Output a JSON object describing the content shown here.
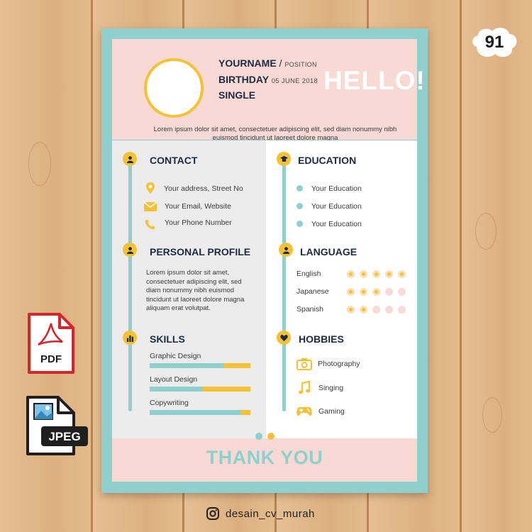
{
  "badge": {
    "number": "91"
  },
  "header": {
    "name": "YOURNAME",
    "slash": " / ",
    "position": "POSITION",
    "birthday_label": "BIRTHDAY",
    "birthday_value": "05 JUNE 2018",
    "status": "SINGLE",
    "greeting": "HELLO!",
    "intro_line1": "Lorem ipsum dolor sit amet, consectetuer adipiscing elit, sed diam nonummy nibh",
    "intro_line2": "euismod tincidunt ut laoreet dolore magna"
  },
  "contact": {
    "title": "CONTACT",
    "items": [
      "Your address, Street No",
      "Your Email, Website",
      "Your Phone Number"
    ]
  },
  "profile": {
    "title": "PERSONAL PROFILE",
    "lines": [
      "Lorem ipsum dolor sit amet,",
      "consectetuer adipiscing elit, sed",
      "diam nonummy nibh euismod",
      "tincidunt ut laoreet dolore magna",
      "aliquam erat volutpat."
    ]
  },
  "skills": {
    "title": "SKILLS",
    "items": [
      {
        "label": "Graphic Design",
        "level": 0.74
      },
      {
        "label": "Layout Design",
        "level": 0.52
      },
      {
        "label": "Copywriting",
        "level": 0.9
      }
    ]
  },
  "education": {
    "title": "EDUCATION",
    "items": [
      "Your Education",
      "Your Education",
      "Your Education"
    ]
  },
  "language": {
    "title": "LANGUAGE",
    "items": [
      {
        "label": "English",
        "level": 5,
        "max": 5
      },
      {
        "label": "Japanese",
        "level": 3,
        "max": 5
      },
      {
        "label": "Spanish",
        "level": 2,
        "max": 5
      }
    ]
  },
  "hobbies": {
    "title": "HOBBIES",
    "items": [
      {
        "label": "Photography",
        "icon": "camera-icon"
      },
      {
        "label": "Singing",
        "icon": "music-note-icon"
      },
      {
        "label": "Gaming",
        "icon": "gamepad-icon"
      }
    ]
  },
  "footer": {
    "text": "THANK YOU"
  },
  "files": {
    "pdf_label": "PDF",
    "jpeg_label": "JPEG"
  },
  "social": {
    "handle": "desain_cv_murah",
    "icon": "instagram-icon"
  },
  "colors": {
    "teal": "#8fcfce",
    "yellow": "#f5c235",
    "pink": "#f8d9d3",
    "navy": "#1d2a44",
    "pdf_red": "#d5262c"
  }
}
